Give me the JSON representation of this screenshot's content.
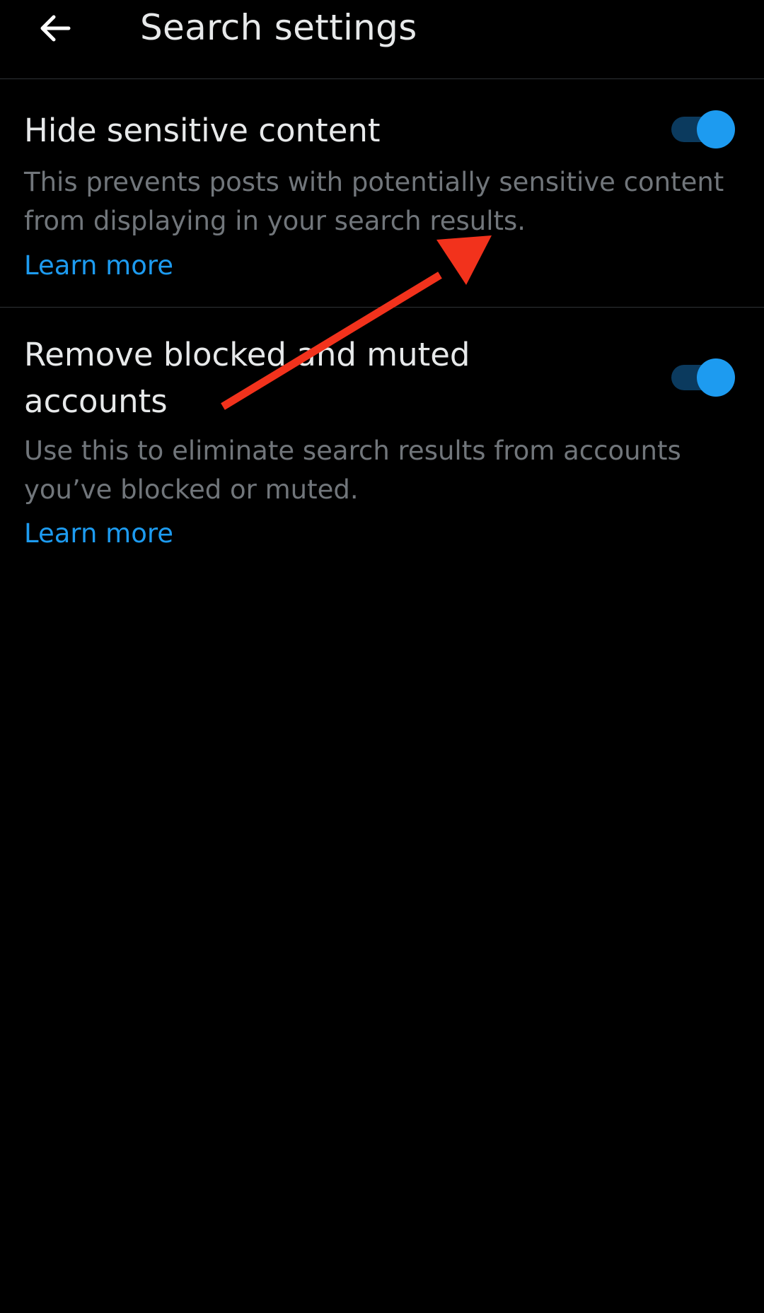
{
  "header": {
    "title": "Search settings",
    "back_icon": "arrow-left-icon"
  },
  "settings": [
    {
      "title": "Hide sensitive content",
      "description": "This prevents posts with potentially sensitive content from displaying in your search results.",
      "link": "Learn more",
      "enabled": true
    },
    {
      "title": "Remove blocked and muted accounts",
      "description": "Use this to eliminate search results from accounts you’ve blocked or muted.",
      "link": "Learn more",
      "enabled": true
    }
  ],
  "colors": {
    "background": "#000000",
    "primary_text": "#e7e9ea",
    "secondary_text": "#71767b",
    "accent": "#1d9bf0",
    "toggle_track": "#0b3a5e",
    "divider": "#2f3336",
    "annotation_arrow": "#f2321c"
  },
  "annotation": {
    "type": "arrow",
    "icon": "red-arrow"
  }
}
